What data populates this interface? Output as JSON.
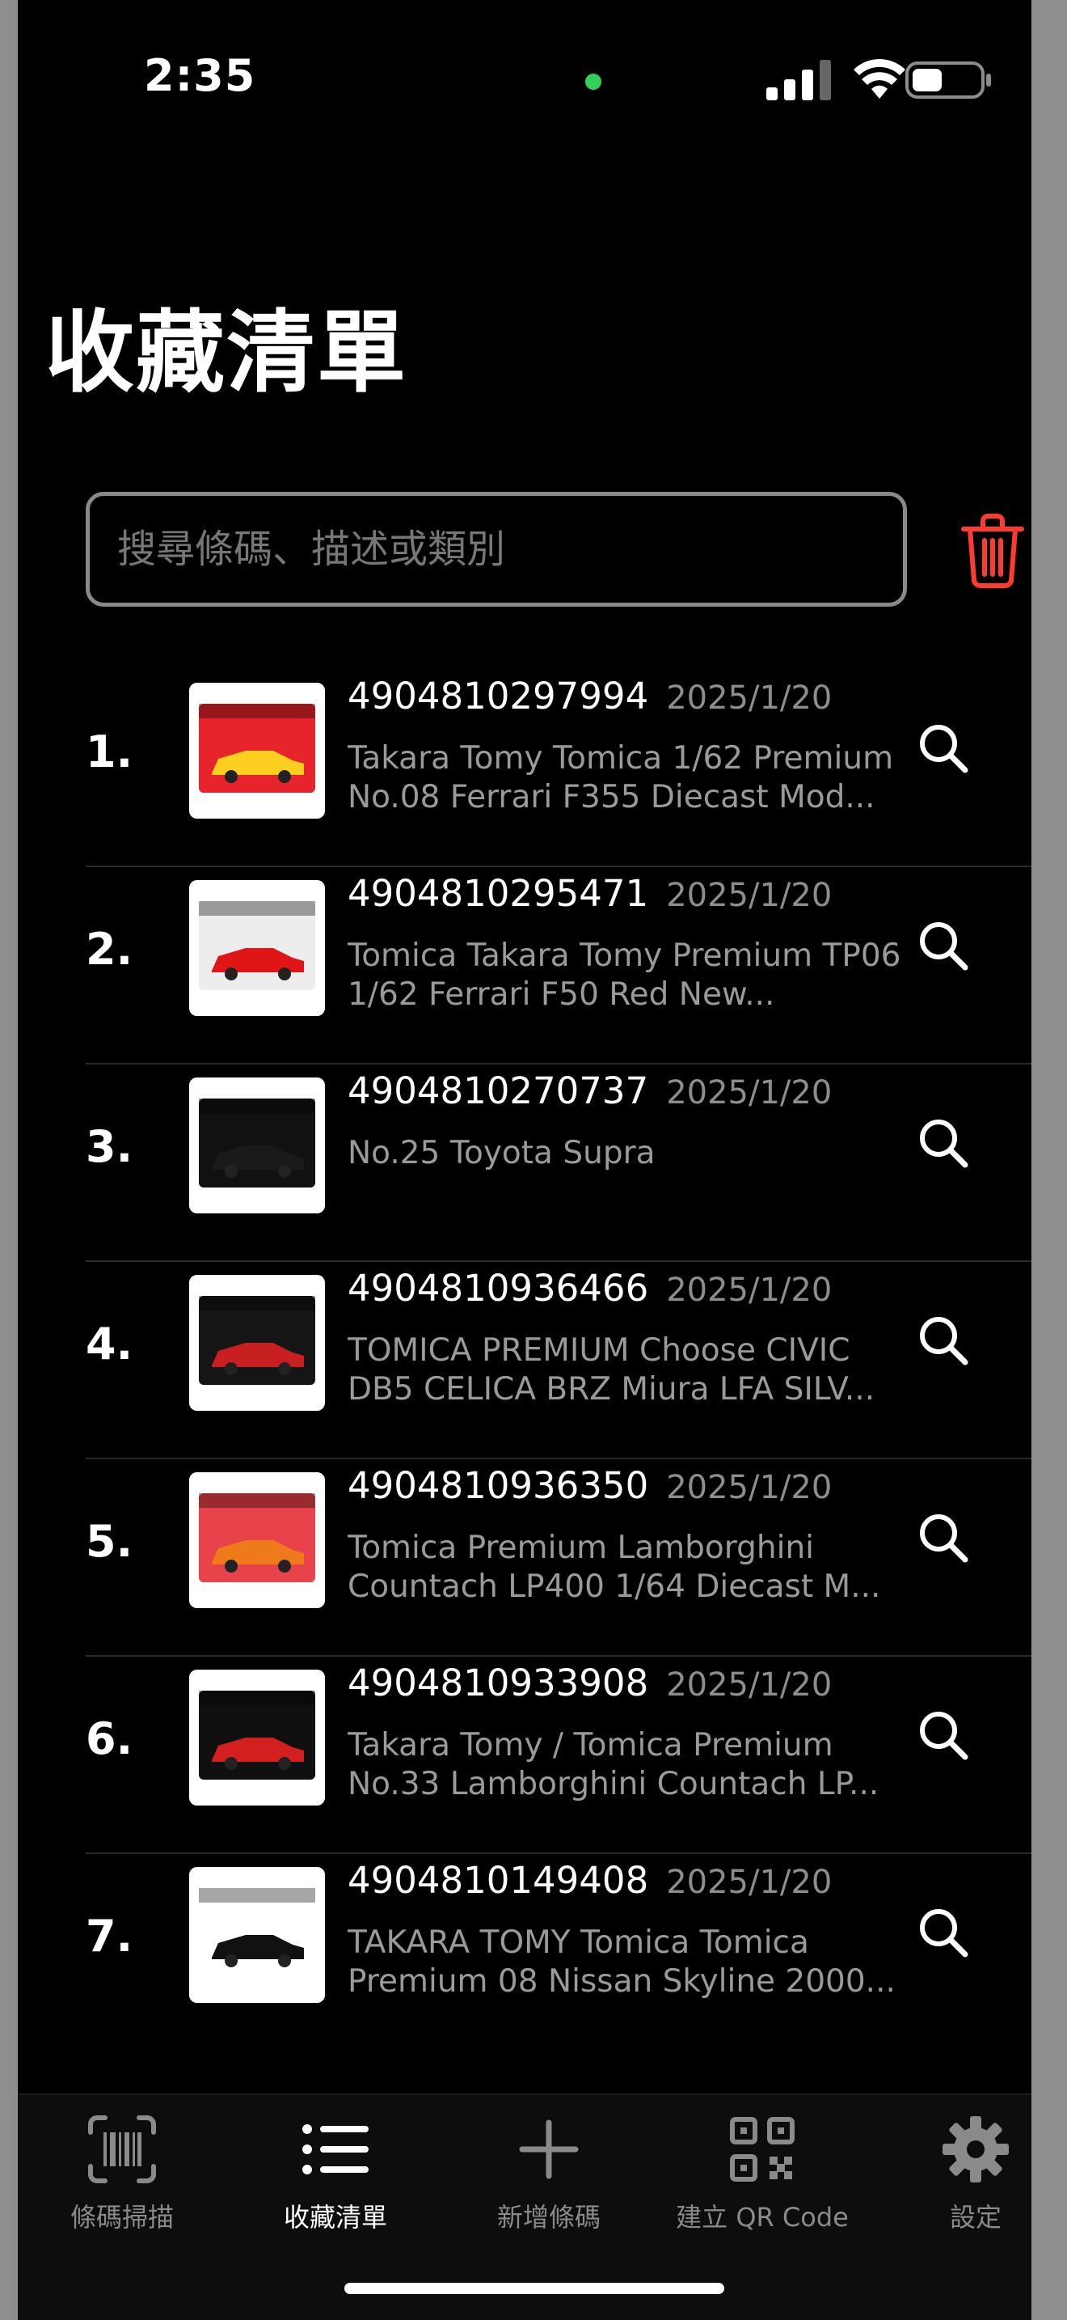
{
  "status": {
    "time": "2:35"
  },
  "page_title": "收藏清單",
  "search": {
    "placeholder": "搜尋條碼、描述或類別"
  },
  "items": [
    {
      "index": "1.",
      "barcode": "4904810297994",
      "date": "2025/1/20",
      "desc": "Takara Tomy Tomica 1/62 Premium No.08 Ferrari F355 Diecast Mod...",
      "thumb_color": "#e7242b",
      "car_color": "#ffcf1f"
    },
    {
      "index": "2.",
      "barcode": "4904810295471",
      "date": "2025/1/20",
      "desc": "Tomica Takara Tomy Premium TP06 1/62 Ferrari F50 Red New...",
      "thumb_color": "#ededed",
      "car_color": "#e01616"
    },
    {
      "index": "3.",
      "barcode": "4904810270737",
      "date": "2025/1/20",
      "desc": "No.25 Toyota Supra",
      "thumb_color": "#111111",
      "car_color": "#1a1a1a"
    },
    {
      "index": "4.",
      "barcode": "4904810936466",
      "date": "2025/1/20",
      "desc": "TOMICA PREMIUM Choose CIVIC DB5 CELICA BRZ Miura LFA SILV...",
      "thumb_color": "#151515",
      "car_color": "#c82020"
    },
    {
      "index": "5.",
      "barcode": "4904810936350",
      "date": "2025/1/20",
      "desc": "Tomica Premium Lamborghini Countach LP400 1/64 Diecast M...",
      "thumb_color": "#e8434b",
      "car_color": "#ef7a1a"
    },
    {
      "index": "6.",
      "barcode": "4904810933908",
      "date": "2025/1/20",
      "desc": "Takara Tomy / Tomica Premium No.33 Lamborghini Countach LP...",
      "thumb_color": "#101010",
      "car_color": "#d41f1f"
    },
    {
      "index": "7.",
      "barcode": "4904810149408",
      "date": "2025/1/20",
      "desc": "TAKARA TOMY Tomica Tomica Premium 08 Nissan Skyline 2000...",
      "thumb_color": "#ffffff",
      "car_color": "#111111"
    }
  ],
  "tabs": [
    {
      "label": "條碼掃描",
      "icon": "barcode-scan-icon"
    },
    {
      "label": "收藏清單",
      "icon": "list-icon"
    },
    {
      "label": "新增條碼",
      "icon": "plus-icon"
    },
    {
      "label": "建立 QR Code",
      "icon": "qrcode-icon"
    },
    {
      "label": "設定",
      "icon": "gear-icon"
    }
  ],
  "colors": {
    "accent_delete": "#ff3b30",
    "indicator_dot": "#30d158"
  }
}
